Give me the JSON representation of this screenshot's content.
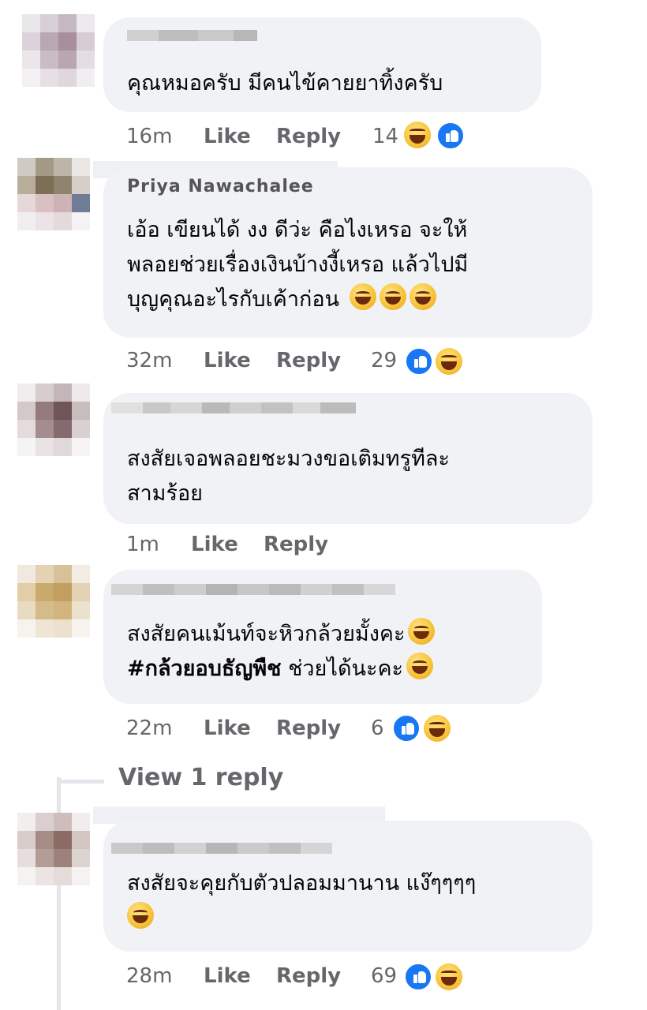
{
  "comments": [
    {
      "author": "",
      "lines": [
        "คุณหมอครับ มีคนไข้คายยาทิ้งครับ"
      ],
      "time": "16m",
      "like_label": "Like",
      "reply_label": "Reply",
      "reaction_count": "14",
      "reactions": [
        "haha",
        "like"
      ]
    },
    {
      "author": "Priya Nawachalee",
      "lines": [
        "เอ้อ เขียนได้ งง ดีว่ะ คือไงเหรอ จะให้",
        "พลอยช่วยเรื่องเงินบ้างงี้เหรอ แล้วไปมี",
        "บุญคุณอะไรกับเค้าก่อน"
      ],
      "time": "32m",
      "like_label": "Like",
      "reply_label": "Reply",
      "reaction_count": "29",
      "reactions": [
        "like",
        "haha"
      ]
    },
    {
      "author": "",
      "lines": [
        "สงสัยเจอพลอยชะมวงขอเติมทรูทีละ",
        "สามร้อย"
      ],
      "time": "1m",
      "like_label": "Like",
      "reply_label": "Reply",
      "reaction_count": "",
      "reactions": []
    },
    {
      "author": "",
      "lines": [
        "สงสัยคนเม้นท์จะหิวกล้วยมั้งคะ",
        "ช่วยได้นะคะ"
      ],
      "hashtag": "#กล้วยอบธัญพืช",
      "time": "22m",
      "like_label": "Like",
      "reply_label": "Reply",
      "reaction_count": "6",
      "reactions": [
        "like",
        "haha"
      ]
    },
    {
      "author": "",
      "lines": [
        "สงสัยจะคุยกับตัวปลอมมานาน แง๊ๆๆๆๆ"
      ],
      "time": "28m",
      "like_label": "Like",
      "reply_label": "Reply",
      "reaction_count": "69",
      "reactions": [
        "like",
        "haha"
      ]
    }
  ],
  "view_replies_label": "View 1 reply",
  "colors": {
    "bubble": "#f0f2f5",
    "meta_text": "#65676b",
    "like_blue": "#1877f2",
    "haha_yellow": "#f7c43a"
  }
}
